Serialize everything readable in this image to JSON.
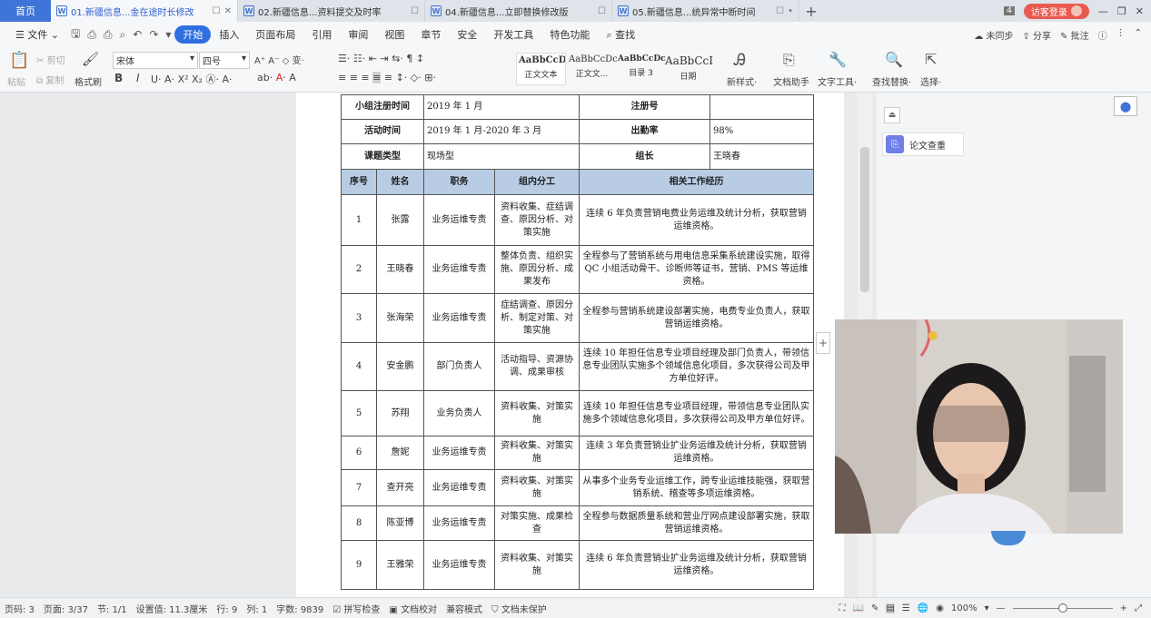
{
  "tabs": {
    "home": "首页",
    "docs": [
      {
        "label": "01.新疆信息...金在途时长修改",
        "active": true
      },
      {
        "label": "02.新疆信息...资料提交及时率",
        "active": false
      },
      {
        "label": "04.新疆信息...立即替换修改版",
        "active": false
      },
      {
        "label": "05.新疆信息...统异常中断时间",
        "active": false
      }
    ],
    "add": "+",
    "count_badge": "4",
    "login_label": "访客登录"
  },
  "menu": {
    "file": "文件",
    "items": [
      "开始",
      "插入",
      "页面布局",
      "引用",
      "审阅",
      "视图",
      "章节",
      "安全",
      "开发工具",
      "特色功能"
    ],
    "search": "查找",
    "sync": "未同步",
    "share": "分享",
    "annotate": "批注"
  },
  "ribbon": {
    "paste": "粘贴",
    "cut": "剪切",
    "copy": "复制",
    "format_painter": "格式刷",
    "font_name": "宋体",
    "font_size": "四号",
    "styles": [
      {
        "preview": "AaBbCcDc",
        "label": "正文文本"
      },
      {
        "preview": "AaBbCcDc",
        "label": "正文文..."
      },
      {
        "preview": "AaBbCcDc",
        "label": "目录 3"
      },
      {
        "preview": "AaBbCcI",
        "label": "日期"
      }
    ],
    "new_style": "新样式",
    "doc_helper": "文档助手",
    "text_tools": "文字工具",
    "find_replace": "查找替换",
    "select": "选择"
  },
  "table": {
    "info": {
      "reg_time_label": "小组注册时间",
      "reg_time": "2019 年 1 月",
      "reg_no_label": "注册号",
      "reg_no": "",
      "act_time_label": "活动时间",
      "act_time": "2019 年 1 月-2020 年 3 月",
      "attendance_label": "出勤率",
      "attendance": "98%",
      "topic_type_label": "课题类型",
      "topic_type": "现场型",
      "leader_label": "组长",
      "leader": "王晓春"
    },
    "headers": [
      "序号",
      "姓名",
      "职务",
      "组内分工",
      "相关工作经历"
    ],
    "rows": [
      {
        "no": "1",
        "name": "张露",
        "role": "业务运维专责",
        "duty": "资料收集、症结调查、原因分析、对策实施",
        "exp": "连续 6 年负责营销电费业务运维及统计分析，获取营销运维资格。"
      },
      {
        "no": "2",
        "name": "王晓春",
        "role": "业务运维专责",
        "duty": "整体负责、组织实施、原因分析、成果发布",
        "exp": "全程参与了营销系统与用电信息采集系统建设实施，取得 QC 小组活动骨干、诊断师等证书，营销、PMS 等运维资格。"
      },
      {
        "no": "3",
        "name": "张海荣",
        "role": "业务运维专责",
        "duty": "症结调查、原因分析、制定对策、对策实施",
        "exp": "全程参与营销系统建设部署实施，电费专业负责人，获取营销运维资格。"
      },
      {
        "no": "4",
        "name": "安金鹏",
        "role": "部门负责人",
        "duty": "活动指导、资源协调、成果审核",
        "exp": "连续 10 年担任信息专业项目经理及部门负责人，带领信息专业团队实施多个领域信息化项目，多次获得公司及甲方单位好评。"
      },
      {
        "no": "5",
        "name": "苏翔",
        "role": "业务负责人",
        "duty": "资料收集、对策实施",
        "exp": "连续 10 年担任信息专业项目经理，带领信息专业团队实施多个领域信息化项目，多次获得公司及甲方单位好评。"
      },
      {
        "no": "6",
        "name": "詹妮",
        "role": "业务运维专责",
        "duty": "资料收集、对策实施",
        "exp": "连续 3 年负责营销业扩业务运维及统计分析，获取营销运维资格。"
      },
      {
        "no": "7",
        "name": "查开亮",
        "role": "业务运维专责",
        "duty": "资料收集、对策实施",
        "exp": "从事多个业务专业运维工作，跨专业运维技能强，获取营销系统、稽查等多项运维资格。"
      },
      {
        "no": "8",
        "name": "陈亚博",
        "role": "业务运维专责",
        "duty": "对策实施、成果检查",
        "exp": "全程参与数据质量系统和营业厅网点建设部署实施，获取营销运维资格。"
      },
      {
        "no": "9",
        "name": "王雅荣",
        "role": "业务运维专责",
        "duty": "资料收集、对策实施",
        "exp": "连续 6 年负责营销业扩业务运维及统计分析，获取营销运维资格。"
      }
    ]
  },
  "side": {
    "paper_check": "论文查重"
  },
  "status": {
    "page_no": "页码: 3",
    "page_of": "页面: 3/37",
    "section": "节: 1/1",
    "position": "设置值: 11.3厘米",
    "line": "行: 9",
    "col": "列: 1",
    "word_count": "字数: 9839",
    "spell": "拼写检查",
    "proof": "文档校对",
    "compat": "兼容模式",
    "protect": "文档未保护",
    "zoom": "100%"
  }
}
